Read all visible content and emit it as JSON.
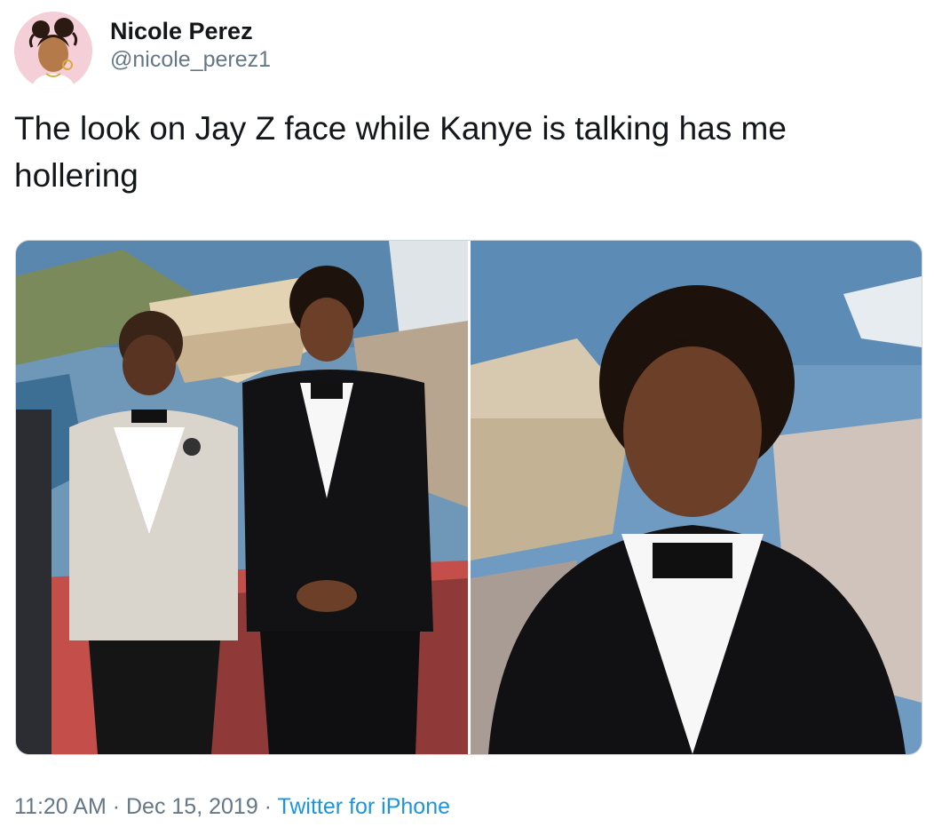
{
  "tweet": {
    "author": {
      "display_name": "Nicole Perez",
      "handle": "@nicole_perez1"
    },
    "text": "The look on Jay Z face while Kanye is talking has me hollering",
    "media": [
      {
        "alt_kind": "photo",
        "description_icon": "photo-two-men-tuxedos"
      },
      {
        "alt_kind": "photo",
        "description_icon": "photo-man-closeup-tuxedo"
      }
    ],
    "meta": {
      "time": "11:20 AM",
      "separator_1": " · ",
      "date": "Dec 15, 2019",
      "separator_2": " · ",
      "source": "Twitter for iPhone"
    }
  },
  "colors": {
    "text_primary": "#14171a",
    "text_secondary": "#657786",
    "link": "#1b95e0",
    "avatar_bg": "#f5cfd8",
    "media_border": "#ccd6dd"
  }
}
